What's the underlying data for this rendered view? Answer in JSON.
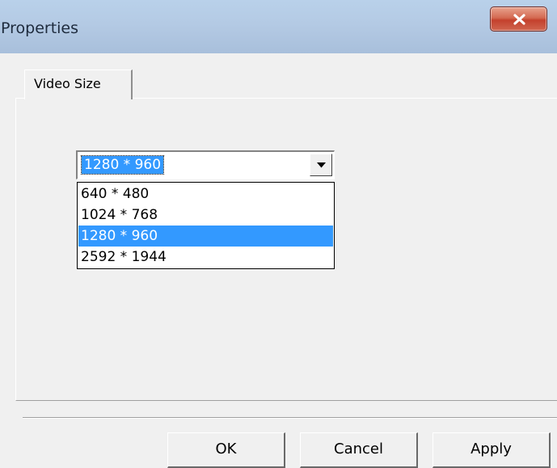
{
  "window": {
    "title": "Properties",
    "close_icon": "close-x-icon"
  },
  "tabs": [
    {
      "label": "Video Size",
      "active": true
    }
  ],
  "video_size": {
    "selected_value": "1280 * 960",
    "dropdown_icon": "chevron-down-icon",
    "options": [
      "640 * 480",
      "1024 * 768",
      "1280 * 960",
      "2592 * 1944"
    ],
    "highlighted_option": "1280 * 960"
  },
  "buttons": {
    "ok_label": "OK",
    "cancel_label": "Cancel",
    "apply_label": "Apply"
  },
  "colors": {
    "selection": "#3399ff",
    "close_button": "#c4412d",
    "title_bar": "#b9d1ea",
    "dialog_face": "#f0f0f0"
  }
}
